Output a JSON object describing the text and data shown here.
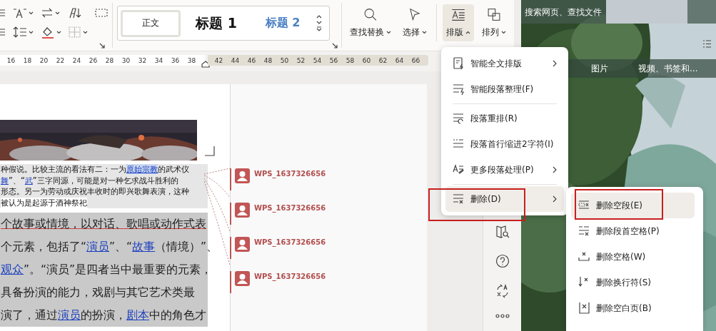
{
  "ribbon": {
    "styles": [
      {
        "label": "正文",
        "kind": "body",
        "selected": true
      },
      {
        "label": "标题 1",
        "kind": "heading1",
        "selected": false
      },
      {
        "label": "标题 2",
        "kind": "heading2",
        "selected": false
      }
    ],
    "tools": [
      {
        "label": "查找替换",
        "kind": "search",
        "selected": false,
        "expanded": false
      },
      {
        "label": "选择",
        "kind": "select",
        "selected": false,
        "expanded": false
      },
      {
        "label": "排版",
        "kind": "layout",
        "selected": true,
        "expanded": true
      },
      {
        "label": "排列",
        "kind": "arrange",
        "selected": false,
        "expanded": false
      }
    ]
  },
  "ruler": {
    "ticks": [
      {
        "label": "16",
        "shaded": false
      },
      {
        "label": "18",
        "shaded": false
      },
      {
        "label": "20",
        "shaded": false
      },
      {
        "label": "22",
        "shaded": false
      },
      {
        "label": "24",
        "shaded": false
      },
      {
        "label": "26",
        "shaded": false
      },
      {
        "label": "28",
        "shaded": false
      },
      {
        "label": "30",
        "shaded": false
      },
      {
        "label": "32",
        "shaded": false
      },
      {
        "label": "34",
        "shaded": false
      },
      {
        "label": "36",
        "shaded": false
      },
      {
        "label": "38",
        "shaded": false
      },
      {
        "label": "42",
        "shaded": true
      },
      {
        "label": "44",
        "shaded": true
      },
      {
        "label": "46",
        "shaded": true
      },
      {
        "label": "48",
        "shaded": true
      },
      {
        "label": "50",
        "shaded": true
      },
      {
        "label": "52",
        "shaded": true
      },
      {
        "label": "54",
        "shaded": true
      },
      {
        "label": "56",
        "shaded": true
      },
      {
        "label": "58",
        "shaded": true
      },
      {
        "label": "60",
        "shaded": true
      },
      {
        "label": "62",
        "shaded": true
      },
      {
        "label": "64",
        "shaded": true
      },
      {
        "label": "66",
        "shaded": true
      }
    ]
  },
  "document": {
    "small_paragraph": [
      [
        {
          "text": "种假说。比较主流的看法有二：一为",
          "link": false
        },
        {
          "text": "原始宗教",
          "link": true
        },
        {
          "text": "的武术仪",
          "link": false
        }
      ],
      [
        {
          "text": "舞",
          "link": true
        },
        {
          "text": "”、“",
          "link": false
        },
        {
          "text": "武",
          "link": true
        },
        {
          "text": "”三字同源，可能是对一种乞求战斗胜利的",
          "link": false
        }
      ],
      [
        {
          "text": "形态。另一为劳动或庆祝丰收时的即兴歌舞表演，这种",
          "link": false
        }
      ],
      [
        {
          "text": "被认为是起源于酒神祭祀",
          "link": false
        }
      ]
    ],
    "lines": [
      [
        {
          "text": "个故事或情境，以对话、歌唱或动作式表",
          "link": false
        }
      ],
      [
        {
          "text": "个元素，包括了“",
          "link": false
        },
        {
          "text": "演员",
          "link": true
        },
        {
          "text": "”、“",
          "link": false
        },
        {
          "text": "故事",
          "link": true
        },
        {
          "text": "（情境）”、",
          "link": false
        }
      ],
      [
        {
          "text": "观众",
          "link": true
        },
        {
          "text": "”。“演员”是四者当中最重要的元素，",
          "link": false
        }
      ],
      [
        {
          "text": "具备扮演的能力，戏剧与其它艺术类最",
          "link": false
        }
      ],
      [
        {
          "text": "演了，通过",
          "link": false
        },
        {
          "text": "演员",
          "link": true
        },
        {
          "text": "的扮演，",
          "link": false
        },
        {
          "text": "剧本",
          "link": true
        },
        {
          "text": "中的角色才",
          "link": false
        }
      ]
    ]
  },
  "comments": [
    {
      "author": "WPS_1637326656"
    },
    {
      "author": "WPS_1637326656"
    },
    {
      "author": "WPS_1637326656"
    },
    {
      "author": "WPS_1637326656"
    }
  ],
  "layout_menu": {
    "groups": [
      [
        {
          "label": "智能全文排版",
          "kind": "smart-doc",
          "has_submenu": true,
          "selected": false,
          "annotated": false
        },
        {
          "label": "智能段落整理(F)",
          "kind": "smart-para",
          "has_submenu": false,
          "selected": false,
          "annotated": false
        }
      ],
      [
        {
          "label": "段落重排(R)",
          "kind": "rearrange",
          "has_submenu": false,
          "selected": false,
          "annotated": false
        },
        {
          "label": "段落首行缩进2字符(I)",
          "kind": "indent",
          "has_submenu": false,
          "selected": false,
          "annotated": false
        },
        {
          "label": "更多段落处理(P)",
          "kind": "more",
          "has_submenu": true,
          "selected": false,
          "annotated": false
        }
      ],
      [
        {
          "label": "删除(D)",
          "kind": "delete",
          "has_submenu": true,
          "selected": true,
          "annotated": true
        }
      ]
    ]
  },
  "delete_menu": {
    "items": [
      {
        "label": "删除空段(E)",
        "kind": "empty-para",
        "selected": true,
        "annotated": true
      },
      {
        "label": "删除段首空格(P)",
        "kind": "lead-space",
        "selected": false,
        "annotated": false
      },
      {
        "label": "删除空格(W)",
        "kind": "space",
        "selected": false,
        "annotated": false
      },
      {
        "label": "删除换行符(S)",
        "kind": "linebreak",
        "selected": false,
        "annotated": false
      },
      {
        "label": "删除空白页(B)",
        "kind": "blank-page",
        "selected": false,
        "annotated": false
      }
    ]
  },
  "browser": {
    "search": {
      "placeholder": "搜索网页、查找文件"
    },
    "tabs": [
      {
        "label": "图片"
      },
      {
        "label": "视频、书签和…"
      }
    ]
  }
}
